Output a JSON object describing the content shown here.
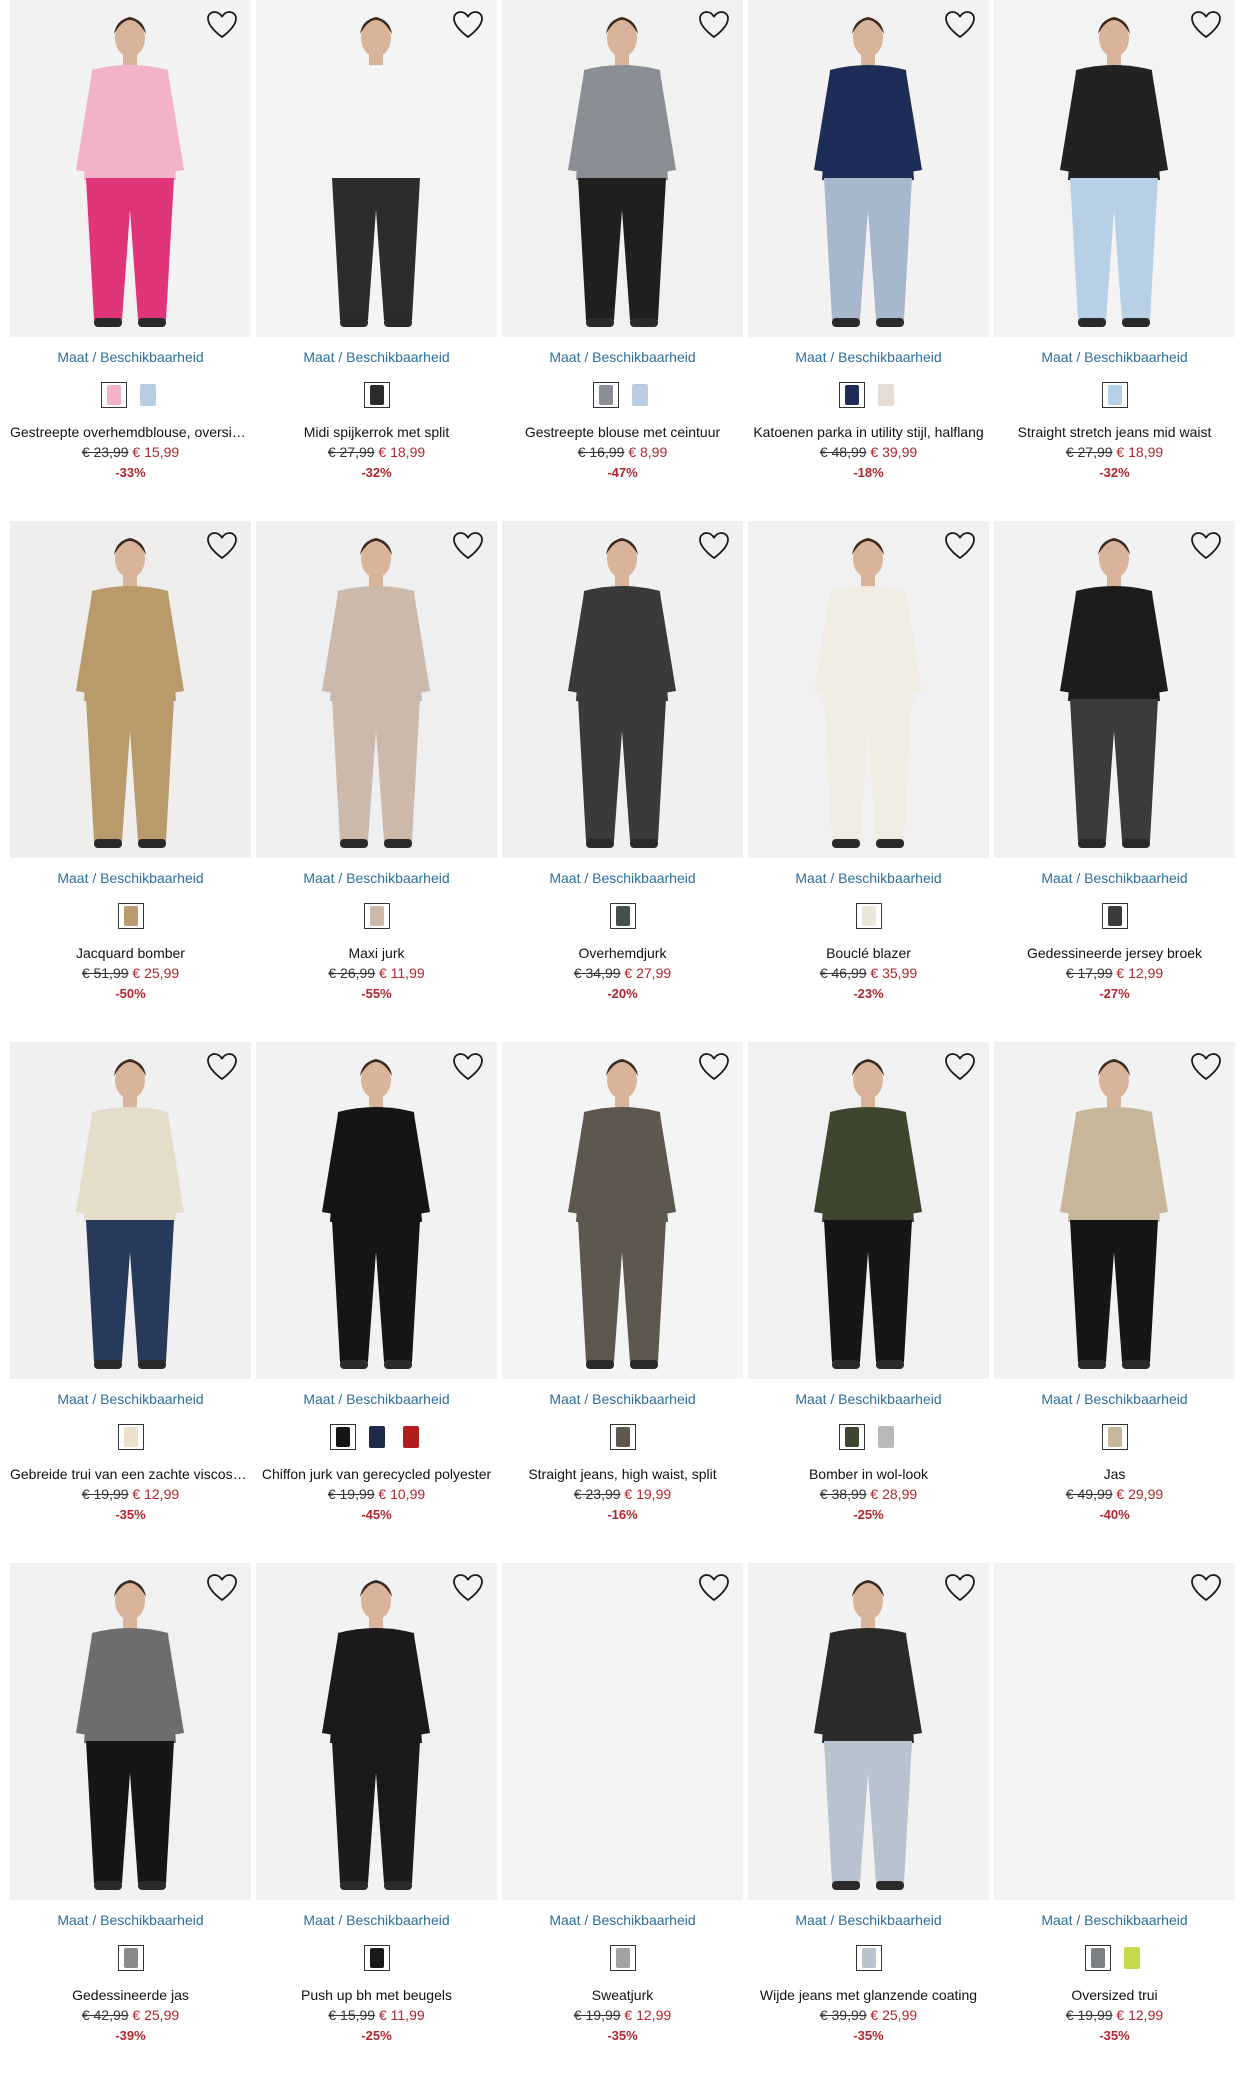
{
  "availability_label": "Maat / Beschikbaarheid",
  "colors": {
    "price_new": "#b1252f",
    "link": "#2a6f9b"
  },
  "products": [
    {
      "name": "Gestreepte overhemdblouse, oversized",
      "old_price": "€ 23,99",
      "new_price": "€ 15,99",
      "discount": "-33%",
      "image": "woman-pink-striped-blouse-pink-trousers",
      "bg": "#f2f2f2",
      "top": "#f3b2c8",
      "bottom": "#e0357a",
      "swatches": [
        "#f3b2c8",
        "#b9cde0"
      ]
    },
    {
      "name": "Midi spijkerrok met split",
      "old_price": "€ 27,99",
      "new_price": "€ 18,99",
      "discount": "-32%",
      "image": "woman-black-denim-midi-skirt",
      "bg": "#f4f4f4",
      "top": "#f5f5f5",
      "bottom": "#2c2c2c",
      "swatches": [
        "#2c2c2c"
      ]
    },
    {
      "name": "Gestreepte blouse met ceintuur",
      "old_price": "€ 16,99",
      "new_price": "€ 8,99",
      "discount": "-47%",
      "image": "woman-grey-striped-blouse-black-bag",
      "bg": "#f1f1f1",
      "top": "#8a8f96",
      "bottom": "#1f1f1f",
      "swatches": [
        "#8a8f96",
        "#b9cde0"
      ]
    },
    {
      "name": "Katoenen parka in utility stijl, halflang",
      "old_price": "€ 48,99",
      "new_price": "€ 39,99",
      "discount": "-18%",
      "image": "woman-navy-parka-back-view",
      "bg": "#f2f2f2",
      "top": "#1e2d57",
      "bottom": "#a7b8cc",
      "swatches": [
        "#1e2d57",
        "#e6dcd2"
      ]
    },
    {
      "name": "Straight stretch jeans mid waist",
      "old_price": "€ 27,99",
      "new_price": "€ 18,99",
      "discount": "-32%",
      "image": "light-blue-straight-jeans",
      "bg": "#f3f3f3",
      "top": "#222222",
      "bottom": "#b8d0e6",
      "swatches": [
        "#b8d0e6"
      ]
    },
    {
      "name": "Jacquard bomber",
      "old_price": "€ 51,99",
      "new_price": "€ 25,99",
      "discount": "-50%",
      "image": "woman-leopard-jacquard-bomber",
      "bg": "#efeeec",
      "top": "#b89a6b",
      "bottom": "#b89a6b",
      "swatches": [
        "#b89a6b"
      ]
    },
    {
      "name": "Maxi jurk",
      "old_price": "€ 26,99",
      "new_price": "€ 11,99",
      "discount": "-55%",
      "image": "woman-taupe-maxi-dress",
      "bg": "#efefef",
      "top": "#cbb9ab",
      "bottom": "#cbb9ab",
      "swatches": [
        "#cbb9ab"
      ]
    },
    {
      "name": "Overhemdjurk",
      "old_price": "€ 34,99",
      "new_price": "€ 27,99",
      "discount": "-20%",
      "image": "woman-black-white-print-shirt-dress",
      "bg": "#f0f0f0",
      "top": "#3a3a3a",
      "bottom": "#3a3a3a",
      "swatches": [
        "#45524a"
      ]
    },
    {
      "name": "Bouclé blazer",
      "old_price": "€ 46,99",
      "new_price": "€ 35,99",
      "discount": "-23%",
      "image": "woman-cream-boucle-blazer-chair",
      "bg": "#f1f1f1",
      "top": "#f1ece2",
      "bottom": "#f1ece2",
      "swatches": [
        "#ece6da"
      ]
    },
    {
      "name": "Gedessineerde jersey broek",
      "old_price": "€ 17,99",
      "new_price": "€ 12,99",
      "discount": "-27%",
      "image": "woman-black-white-print-trousers",
      "bg": "#f2f2f2",
      "top": "#1c1c1c",
      "bottom": "#3b3b3b",
      "swatches": [
        "#3b3b3b"
      ]
    },
    {
      "name": "Gebreide trui van een zachte viscose mix",
      "old_price": "€ 19,99",
      "new_price": "€ 12,99",
      "discount": "-35%",
      "image": "woman-beige-knit-sweater-jeans",
      "bg": "#f0f0f0",
      "top": "#e5dcca",
      "bottom": "#283a5b",
      "swatches": [
        "#ede0cb"
      ]
    },
    {
      "name": "Chiffon jurk van gerecycled polyester",
      "old_price": "€ 19,99",
      "new_price": "€ 10,99",
      "discount": "-45%",
      "image": "woman-black-chiffon-dress",
      "bg": "#f2f2f2",
      "top": "#151515",
      "bottom": "#151515",
      "swatches": [
        "#151515",
        "#1f2b4a",
        "#b21d1d"
      ]
    },
    {
      "name": "Straight jeans, high waist, split",
      "old_price": "€ 23,99",
      "new_price": "€ 19,99",
      "discount": "-16%",
      "image": "grey-brown-straight-jeans-flat",
      "bg": "#f4f4f4",
      "top": "#5d574d",
      "bottom": "#5d574d",
      "swatches": [
        "#5d574d"
      ]
    },
    {
      "name": "Bomber in wol-look",
      "old_price": "€ 38,99",
      "new_price": "€ 28,99",
      "discount": "-25%",
      "image": "woman-olive-bomber-beanie",
      "bg": "#f1f1f1",
      "top": "#3e4630",
      "bottom": "#161616",
      "swatches": [
        "#3e4630",
        "#b9b9b9"
      ]
    },
    {
      "name": "Jas",
      "old_price": "€ 49,99",
      "new_price": "€ 29,99",
      "discount": "-40%",
      "image": "woman-beige-jacket-black-trousers",
      "bg": "#f2f2f2",
      "top": "#c8b69a",
      "bottom": "#161616",
      "swatches": [
        "#c8b69a"
      ]
    },
    {
      "name": "Gedessineerde jas",
      "old_price": "€ 42,99",
      "new_price": "€ 25,99",
      "discount": "-39%",
      "image": "woman-houndstooth-jacket-black-skirt",
      "bg": "#f1f1f1",
      "top": "#6d6d6d",
      "bottom": "#161616",
      "swatches": [
        "#8a8a8a"
      ]
    },
    {
      "name": "Push up bh met beugels",
      "old_price": "€ 15,99",
      "new_price": "€ 11,99",
      "discount": "-25%",
      "image": "woman-black-lingerie-kimono",
      "bg": "#f2f2f2",
      "top": "#1a1a1a",
      "bottom": "#1a1a1a",
      "swatches": [
        "#1a1a1a"
      ]
    },
    {
      "name": "Sweatjurk",
      "old_price": "€ 19,99",
      "new_price": "€ 12,99",
      "discount": "-35%",
      "image": "empty-product-photo",
      "bg": "#f3f3f3",
      "top": "",
      "bottom": "",
      "swatches": [
        "#a0a39e"
      ]
    },
    {
      "name": "Wijde jeans met glanzende coating",
      "old_price": "€ 39,99",
      "new_price": "€ 25,99",
      "discount": "-35%",
      "image": "woman-silver-coated-wide-jeans",
      "bg": "#f2f2f2",
      "top": "#2a2a2a",
      "bottom": "#b7c3cf",
      "swatches": [
        "#b7c3cf"
      ]
    },
    {
      "name": "Oversized trui",
      "old_price": "€ 19,99",
      "new_price": "€ 12,99",
      "discount": "-35%",
      "image": "empty-product-photo",
      "bg": "#f3f3f3",
      "top": "",
      "bottom": "",
      "swatches": [
        "#7c7f84",
        "#c9d84a"
      ]
    }
  ]
}
